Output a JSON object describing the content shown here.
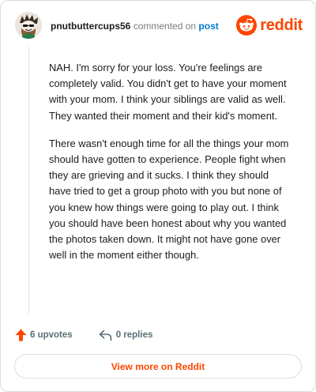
{
  "header": {
    "username": "pnutbuttercups56",
    "action_text": "commented on",
    "post_link": "post",
    "brand": "reddit"
  },
  "comment": {
    "paragraphs": [
      "NAH. I'm sorry for your loss. You're feelings are completely valid. You didn't get to have your moment with your mom. I think your siblings are valid as well. They wanted their moment and their kid's moment.",
      "There wasn't enough time for all the things your mom should have gotten to experience. People fight when they are grieving and it sucks. I think they should have tried to get a group photo with you but none of you knew how things were going to play out. I think you should have been honest about why you wanted the photos taken down. It might not have gone over well in the moment either though."
    ]
  },
  "actions": {
    "upvotes": "6 upvotes",
    "replies": "0 replies"
  },
  "footer": {
    "view_more": "View more on Reddit"
  },
  "colors": {
    "brand": "#ff4500",
    "link": "#0079d3",
    "muted": "#576f76",
    "upvote_arrow": "#ff4500"
  },
  "icons": {
    "avatar": "snoo-avatar",
    "brand": "reddit-snoo-icon",
    "upvote": "upvote-arrow-icon",
    "reply": "reply-arrow-icon"
  }
}
